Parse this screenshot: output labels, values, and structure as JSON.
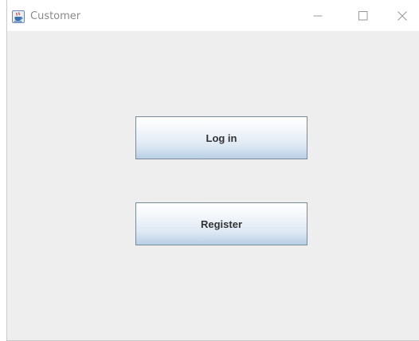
{
  "window": {
    "title": "Customer",
    "icon": "java-cup-icon",
    "controls": [
      "minimize-icon",
      "maximize-icon",
      "close-icon"
    ]
  },
  "buttons": {
    "login_label": "Log in",
    "register_label": "Register"
  },
  "colors": {
    "window_background": "#eeeeee",
    "title_bar_background": "#ffffff",
    "title_text": "#8a8a8a",
    "button_border": "#7a8a99",
    "button_gradient_top": "#ffffff",
    "button_gradient_bottom": "#b8cfe5",
    "button_text": "#333333"
  }
}
